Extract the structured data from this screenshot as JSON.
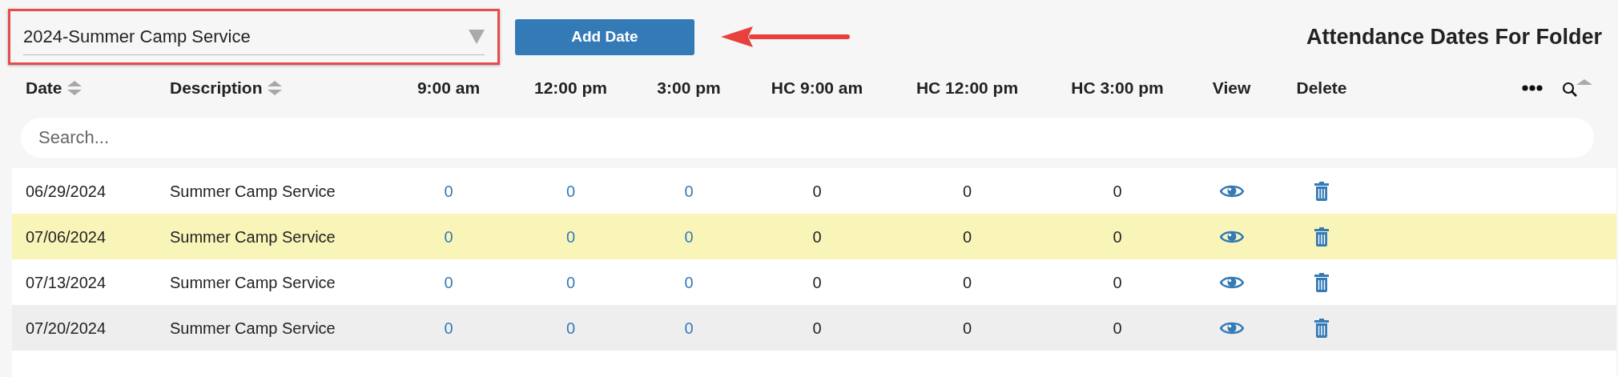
{
  "folder_select": {
    "value": "2024-Summer Camp Service"
  },
  "add_button": "Add Date",
  "title": "Attendance Dates For Folder",
  "columns": [
    {
      "label": "Date",
      "sortable": true,
      "kind": "text"
    },
    {
      "label": "Description",
      "sortable": true,
      "kind": "text"
    },
    {
      "label": "9:00 am",
      "sortable": false,
      "kind": "link"
    },
    {
      "label": "12:00 pm",
      "sortable": false,
      "kind": "link"
    },
    {
      "label": "3:00 pm",
      "sortable": false,
      "kind": "link"
    },
    {
      "label": "HC 9:00 am",
      "sortable": false,
      "kind": "number"
    },
    {
      "label": "HC 12:00 pm",
      "sortable": false,
      "kind": "number"
    },
    {
      "label": "HC 3:00 pm",
      "sortable": false,
      "kind": "number"
    },
    {
      "label": "View",
      "sortable": false,
      "kind": "view"
    },
    {
      "label": "Delete",
      "sortable": false,
      "kind": "delete"
    }
  ],
  "search": {
    "placeholder": "Search..."
  },
  "rows": [
    {
      "selected": false,
      "cells": [
        "06/29/2024",
        "Summer Camp Service",
        "0",
        "0",
        "0",
        "0",
        "0",
        "0"
      ]
    },
    {
      "selected": true,
      "cells": [
        "07/06/2024",
        "Summer Camp Service",
        "0",
        "0",
        "0",
        "0",
        "0",
        "0"
      ]
    },
    {
      "selected": false,
      "cells": [
        "07/13/2024",
        "Summer Camp Service",
        "0",
        "0",
        "0",
        "0",
        "0",
        "0"
      ]
    },
    {
      "selected": false,
      "cells": [
        "07/20/2024",
        "Summer Camp Service",
        "0",
        "0",
        "0",
        "0",
        "0",
        "0"
      ]
    }
  ]
}
